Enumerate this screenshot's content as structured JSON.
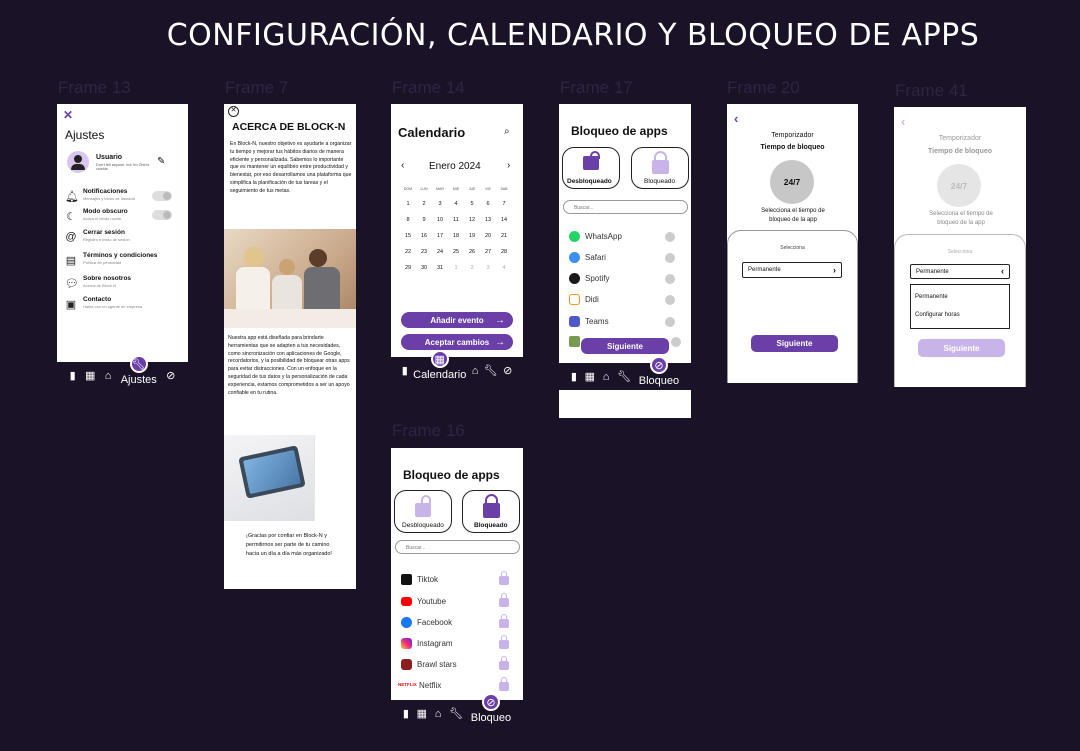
{
  "page_title": "CONFIGURACIÓN, CALENDARIO Y BLOQUEO DE APPS",
  "frame_labels": [
    "Frame 13",
    "Frame 7",
    "Frame 14",
    "Frame 17",
    "Frame 20",
    "Frame 41",
    "Frame 16"
  ],
  "ajustes": {
    "title": "Ajustes",
    "user_name": "Usuario",
    "user_sub": "Don't tell anyone, but I'm Ohio's culshis.",
    "items": [
      {
        "title": "Notificaciones",
        "sub": "Mensajes y tonos de llamada"
      },
      {
        "title": "Modo obscuro",
        "sub": "Activa el Modo noche"
      },
      {
        "title": "Cerrar sesión",
        "sub": "Registro e inicio de sesión"
      },
      {
        "title": "Términos y condiciones",
        "sub": "Política de privacidad"
      },
      {
        "title": "Sobre nosotros",
        "sub": "Acerca de Block-N"
      },
      {
        "title": "Contacto",
        "sub": "Habla con un agente de empresa"
      }
    ],
    "nav_label": "Ajustes"
  },
  "acerca": {
    "title": "ACERCA DE BLOCK-N",
    "p1": "En Block-N, nuestro objetivo es ayudarte a organizar tu tiempo y mejorar tus hábitos diarios de manera eficiente y personalizada. Sabemos lo importante que es mantener un equilibrio entre productividad y bienestar, por eso desarrollamos una plataforma que simplifica la planificación de tus tareas y el seguimiento de tus metas.",
    "p2": "Nuestra app está diseñada para brindarte herramientas que se adapten a tus necesidades, como sincronización con aplicaciones de Google, recordatorios, y la posibilidad de bloquear otras apps para evitar distracciones. Con un enfoque en la seguridad de tus datos y la personalización de cada experiencia, estamos comprometidos a ser un apoyo confiable en tu rutina.",
    "p3": "¡Gracias por confiar en Block-N y permitirnos ser parte de tu camino hacia un día a día más organizado!"
  },
  "calendario": {
    "title": "Calendario",
    "month": "Enero 2024",
    "weekdays": [
      "DOM",
      "LUN",
      "MAR",
      "MIE",
      "JUE",
      "VIE",
      "SAB"
    ],
    "rows": [
      [
        "",
        "1",
        "2",
        "3",
        "4",
        "5",
        "6",
        "7"
      ],
      [
        "8",
        "9",
        "10",
        "11",
        "12",
        "13",
        "14"
      ],
      [
        "15",
        "16",
        "17",
        "18",
        "19",
        "20",
        "21"
      ],
      [
        "22",
        "23",
        "24",
        "25",
        "26",
        "27",
        "28"
      ],
      [
        "29",
        "30",
        "31",
        "1",
        "2",
        "3",
        "4"
      ]
    ],
    "add_event": "Añadir evento",
    "accept": "Aceptar cambios",
    "nav_label": "Calendario"
  },
  "bloqueo17": {
    "title": "Bloqueo de apps",
    "unlocked": "Desbloqueado",
    "locked": "Bloqueado",
    "search": "Buscar...",
    "apps": [
      "WhatsApp",
      "Safari",
      "Spotify",
      "Didi",
      "Teams"
    ],
    "next": "Siguiente",
    "nav_label": "Bloqueo"
  },
  "bloqueo16": {
    "title": "Bloqueo de apps",
    "unlocked": "Desbloqueado",
    "locked": "Bloqueado",
    "search": "Buscar...",
    "apps": [
      "Tiktok",
      "Youtube",
      "Facebook",
      "Instagram",
      "Brawl stars",
      "Netflix"
    ],
    "nav_label": "Bloqueo"
  },
  "temporizador": {
    "heading": "Temporizador",
    "subheading": "Tiempo de bloqueo",
    "circle": "24/7",
    "desc": "Selecciona el tiempo de bloqueo de la app",
    "select_label": "Selecciona",
    "select_value": "Permanente",
    "options": [
      "Permanente",
      "Configurar horas"
    ],
    "next": "Siguiente"
  },
  "colors": {
    "bg": "#1a1227",
    "accent": "#6a3fa8",
    "light": "#c9b4ea"
  }
}
